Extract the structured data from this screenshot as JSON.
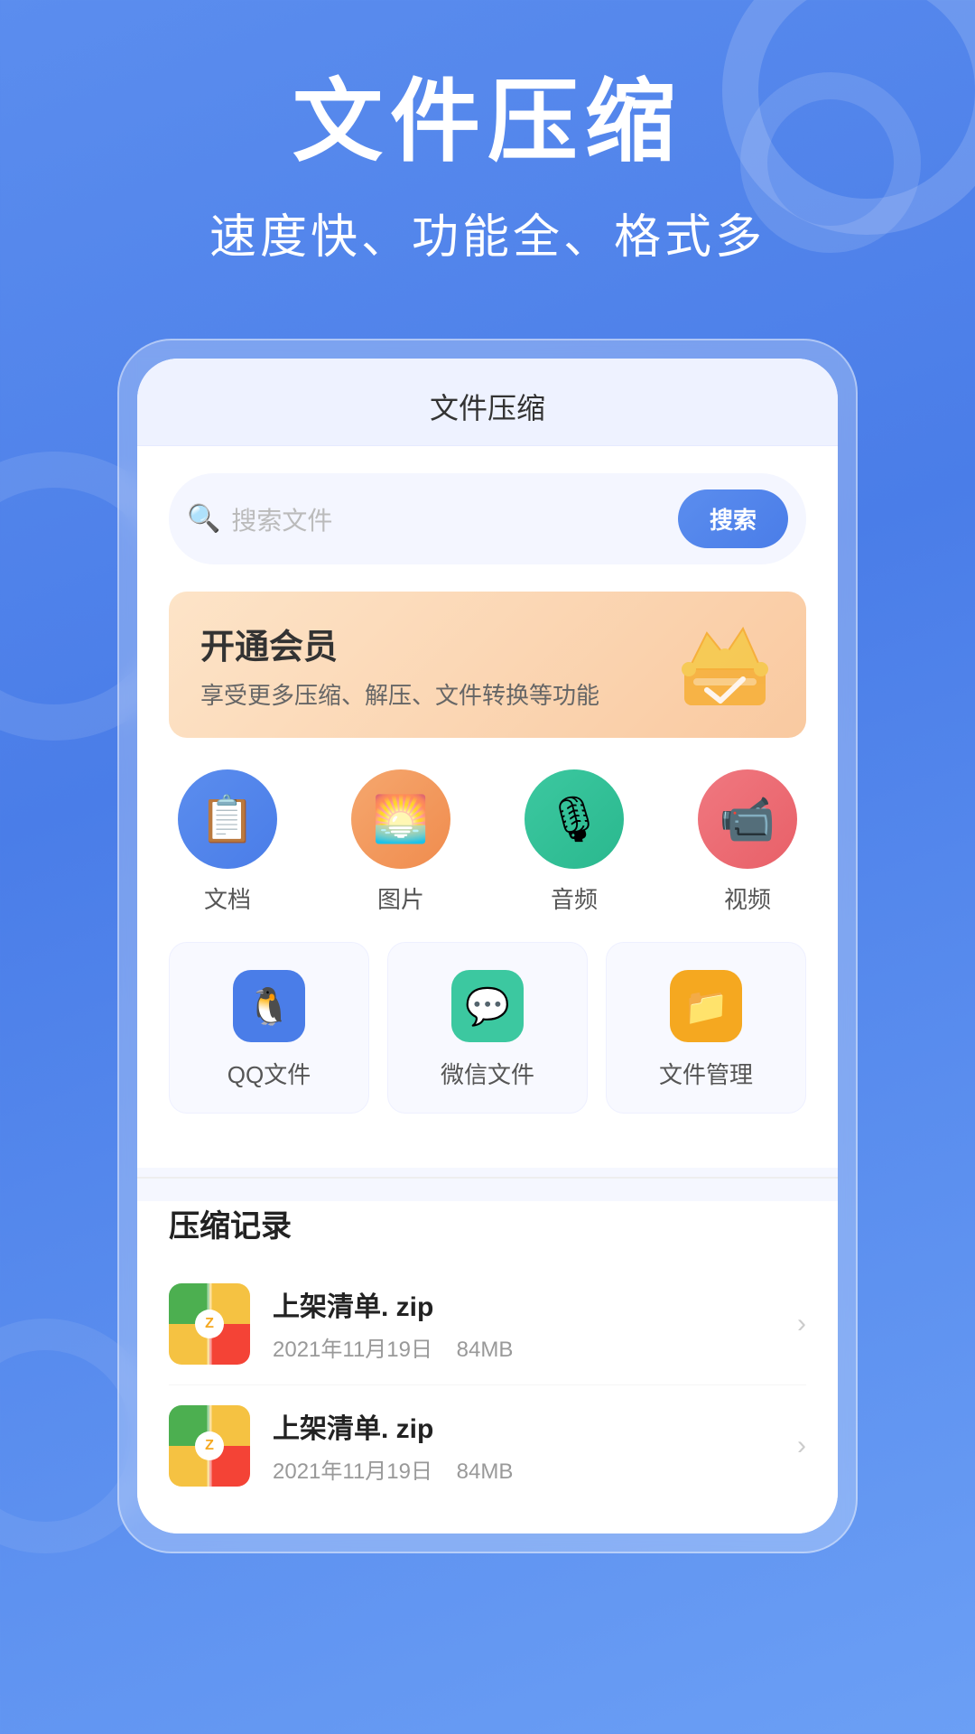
{
  "app": {
    "background_color_top": "#5b8dee",
    "background_color_bottom": "#4a7de8"
  },
  "header": {
    "main_title": "文件压缩",
    "sub_title": "速度快、功能全、格式多"
  },
  "phone": {
    "topbar_title": "文件压缩",
    "search": {
      "placeholder": "搜索文件",
      "button_label": "搜索"
    },
    "vip_banner": {
      "title": "开通会员",
      "description": "享受更多压缩、解压、文件转换等功能"
    },
    "categories": [
      {
        "id": "doc",
        "label": "文档",
        "icon": "📋",
        "color_class": "cat-blue"
      },
      {
        "id": "img",
        "label": "图片",
        "icon": "🖼",
        "color_class": "cat-orange"
      },
      {
        "id": "audio",
        "label": "音频",
        "icon": "🎙",
        "color_class": "cat-teal"
      },
      {
        "id": "video",
        "label": "视频",
        "icon": "📹",
        "color_class": "cat-pink"
      }
    ],
    "quick_access": [
      {
        "id": "qq",
        "label": "QQ文件",
        "icon": "🐧",
        "color_class": "qi-blue"
      },
      {
        "id": "wechat",
        "label": "微信文件",
        "icon": "💬",
        "color_class": "qi-teal"
      },
      {
        "id": "files",
        "label": "文件管理",
        "icon": "📁",
        "color_class": "qi-yellow"
      }
    ],
    "records": {
      "title": "压缩记录",
      "items": [
        {
          "name": "上架清单. zip",
          "date": "2021年11月19日",
          "size": "84MB"
        },
        {
          "name": "上架清单. zip",
          "date": "2021年11月19日",
          "size": "84MB"
        }
      ]
    }
  }
}
